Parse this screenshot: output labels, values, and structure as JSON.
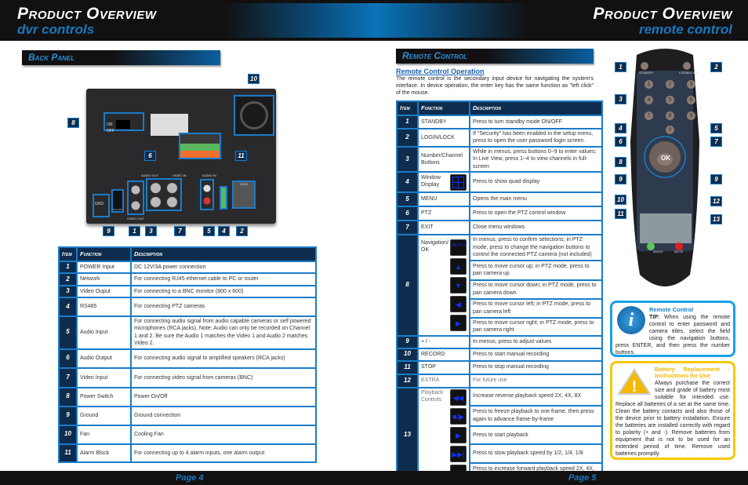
{
  "header": {
    "left_title": "Product Overview",
    "left_sub": "dvr controls",
    "right_title": "Product Overview",
    "right_sub": "remote control"
  },
  "left": {
    "section": "Back Panel",
    "panel_labels": {
      "on": "ON",
      "off": "OFF",
      "gnd": "GND",
      "audio_out": "AUDIO OUT",
      "video_in": "VIDEO IN",
      "audio_in": "AUDIO IN",
      "video_out": "VIDEO OUT",
      "dc": "DC+12V",
      "rj45": "RJ45"
    },
    "callouts": [
      "10",
      "8",
      "6",
      "11",
      "9",
      "1",
      "3",
      "7",
      "5",
      "4",
      "2"
    ],
    "table": {
      "headers": [
        "Item",
        "Function",
        "Description"
      ],
      "rows": [
        [
          "1",
          "POWER Input",
          "DC 12V/3A power connection"
        ],
        [
          "2",
          "Network",
          "For connecting RJ45 ethernet cable to PC or router"
        ],
        [
          "3",
          "Video Ouput",
          "For connecting to a BNC monitor (800 x 600)"
        ],
        [
          "4",
          "RS485",
          "For connecting PTZ cameras"
        ],
        [
          "5",
          "Audio Input",
          "For connecting audio signal from audio capable cameras or self powered microphones (RCA jacks). Note: Audio can only be recorded on Channel 1 and 2. Be sure the Audio 1 matches the Video 1 and  Audio 2 matches Video 2."
        ],
        [
          "6",
          "Audio Output",
          "For connecting audio signal to amplified speakers (RCA jacks)"
        ],
        [
          "7",
          "Video Input",
          "For connecting video signal from cameras (BNC)"
        ],
        [
          "8",
          "Power Switch",
          "Power On/Off"
        ],
        [
          "9",
          "Ground",
          "Ground connection"
        ],
        [
          "10",
          "Fan",
          "Cooling Fan"
        ],
        [
          "11",
          "Alarm Block",
          "For connecting up to 4 alarm inputs, one alarm output"
        ]
      ]
    },
    "page": "Page 4"
  },
  "right": {
    "section": "Remote Control",
    "op_title": "Remote Control Operation",
    "op_text": "The remote control is the secondary input device for navigating the system's interface. In device operation, the enter key has the same function as \"left click\" of the mouse.",
    "table": {
      "headers": [
        "Item",
        "Function",
        "Description"
      ],
      "rows": [
        {
          "item": "1",
          "func": "STANDBY",
          "desc": [
            "Press to turn standby mode ON/OFF"
          ]
        },
        {
          "item": "2",
          "func": "LOGIN/LOCK",
          "desc": [
            "If \"Security\" has been enabled in the setup menu, press to open the user password login screen."
          ]
        },
        {
          "item": "3",
          "func": "Number/Channel Buttons",
          "desc": [
            "While in menus, press buttons 0~9 to enter values; In Live View, press 1~4 to view channels in full-screen"
          ]
        },
        {
          "item": "4",
          "func": "Window Display",
          "icons": [
            "quad"
          ],
          "desc": [
            "Press to show quad display"
          ]
        },
        {
          "item": "5",
          "func": "MENU",
          "desc": [
            "Opens the main menu"
          ]
        },
        {
          "item": "6",
          "func": "PTZ",
          "desc": [
            "Press to open the PTZ control window"
          ]
        },
        {
          "item": "7",
          "func": "EXIT",
          "desc": [
            "Close menu windows"
          ]
        },
        {
          "item": "8",
          "func": "Navigation/ OK",
          "icons": [
            "OK PTZ",
            "▲",
            "▼",
            "◀",
            "▶"
          ],
          "desc": [
            "In menus, press to confirm selections; in PTZ mode, press to change the navigation buttons to control the connected PTZ camera (not included)",
            "Press to move cursor up; in PTZ mode, press to pan camera up",
            "Press to move cursor down; in PTZ mode, press to pan camera down",
            "Press to move cursor left; in PTZ mode, press to pan camera left",
            "Press to move cursor right; in PTZ mode, press to pan camera right"
          ]
        },
        {
          "item": "9",
          "func": "+ / -",
          "desc": [
            "In menus, press to adjust values"
          ]
        },
        {
          "item": "10",
          "func": "RECORD",
          "desc": [
            "Press to start manual recording"
          ]
        },
        {
          "item": "11",
          "func": "STOP",
          "desc": [
            "Press to stop manual recording"
          ]
        },
        {
          "item": "12",
          "func": "EXTRA",
          "desc": [
            "For future use"
          ]
        },
        {
          "item": "13",
          "func": "Playback Controls",
          "icons": [
            "◀◀",
            "■/▶",
            "▶",
            "▶▶|",
            "▶▶"
          ],
          "desc": [
            "Increase reverse playback speed 2X, 4X, 8X",
            "Press to freeze playback to one frame, then press again to advance frame-by-frame",
            "Press to start playback",
            "Press to slow playback speed by 1/2, 1/4, 1/8",
            "Press to increase forward playback speed 2X, 4X, 8X"
          ]
        }
      ]
    },
    "remote_labels": {
      "standby": "STANDBY",
      "login": "LOGIN/LOCK",
      "ok": "OK",
      "audio": "AUDIO",
      "mute": "MUTE",
      "keys": [
        "1",
        "2",
        "3",
        "4",
        "5",
        "6",
        "7",
        "8",
        "9",
        "0"
      ]
    },
    "remote_callouts": [
      "1",
      "2",
      "3",
      "4",
      "5",
      "6",
      "7",
      "8",
      "9",
      "9",
      "10",
      "12",
      "11",
      "13"
    ],
    "tip": {
      "title": "Remote Control",
      "lead": "TIP:",
      "text": "When using the remote control to enter password and camera titles, select the field using the navigation buttons, press ENTER, and then press the number buttons."
    },
    "battery": {
      "title": "Battery Replacement - Instructions for Use",
      "text": "Always purchase the correct size and grade of battery most suitable for intended use. Replace all batteries of a set at the same time. Clean the battery contacts and also those of the device prior to battery installation. Ensure the batteries are installed correctly with regard to polarity (+ and -). Remove batteries from equipment that is not to be used for an extended period of time. Remove used batteries promptly."
    },
    "page": "Page 5"
  },
  "colors": {
    "accent": "#1a7cc8",
    "navy": "#0e2d4e",
    "yellow": "#f7c800"
  }
}
